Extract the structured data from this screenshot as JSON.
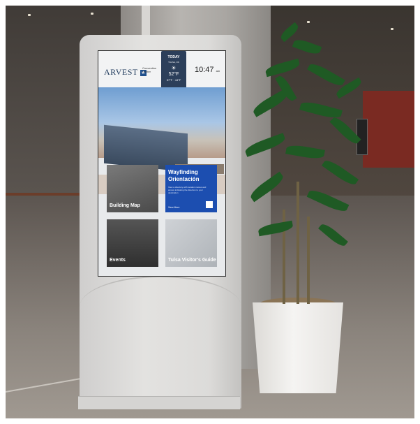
{
  "kiosk": {
    "header": {
      "logo_word": "ARVEST",
      "logo_sub": "Convention Center",
      "time": "10:47",
      "time_suffix": "am"
    },
    "weather": {
      "label": "TODAY",
      "location": "TULSA, OK",
      "icon": "sun-icon",
      "temp": "52°F",
      "range": "57°F · 44°F"
    },
    "tiles": [
      {
        "label": "Building Map"
      },
      {
        "label": "Wayfinding Orientación",
        "description": "View a directory with location names and arrows indicating the direction to your destination",
        "more": "View More"
      },
      {
        "label": "Events"
      },
      {
        "label": "Tulsa Visitor's Guide"
      }
    ]
  },
  "colors": {
    "tile_blue": "#1c4eb0",
    "weather_navy": "#2c3f5a",
    "kiosk_body": "#e0dfdd",
    "plant_green": "#1f5a24"
  }
}
